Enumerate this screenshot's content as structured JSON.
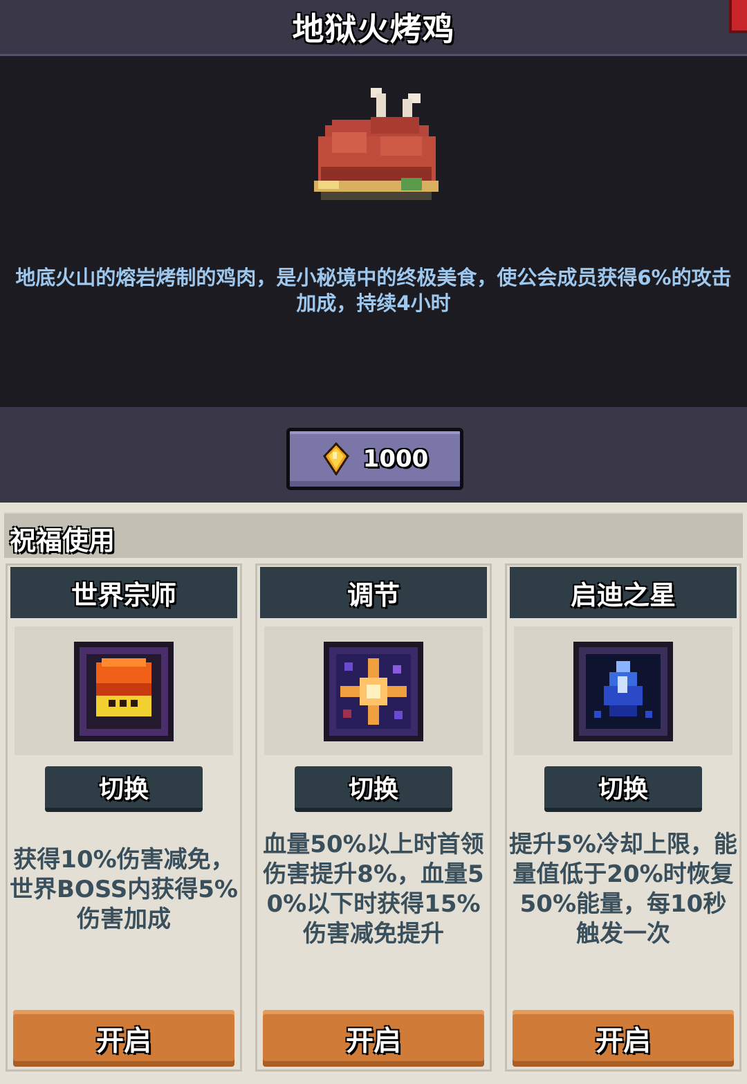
{
  "item": {
    "title": "地狱火烤鸡",
    "description": "地底火山的熔岩烤制的鸡肉，是小秘境中的终极美食，使公会成员获得6%的攻击加成，持续4小时",
    "icon": "roast-chicken-icon"
  },
  "price": {
    "value": "1000",
    "currency_icon": "gold-gem-icon"
  },
  "blessing": {
    "section_title": "祝福使用",
    "cards": [
      {
        "name": "世界宗师",
        "icon": "world-master-icon",
        "switch_label": "切换",
        "description": "获得10%伤害减免，世界BOSS内获得5%伤害加成",
        "open_label": "开启"
      },
      {
        "name": "调节",
        "icon": "regulation-star-icon",
        "switch_label": "切换",
        "description": "血量50%以上时首领伤害提升8%，血量50%以下时获得15%伤害减免提升",
        "open_label": "开启"
      },
      {
        "name": "启迪之星",
        "icon": "enlightenment-star-icon",
        "switch_label": "切换",
        "description": "提升5%冷却上限，能量值低于20%时恢复50%能量，每10秒触发一次",
        "open_label": "开启"
      }
    ]
  },
  "colors": {
    "title_bar": "#3a3848",
    "food_panel": "#1c1b22",
    "description_text": "#9ec8ee",
    "card_header": "#2f3e46",
    "open_button": "#d07c38",
    "card_text": "#3a4f5c"
  }
}
